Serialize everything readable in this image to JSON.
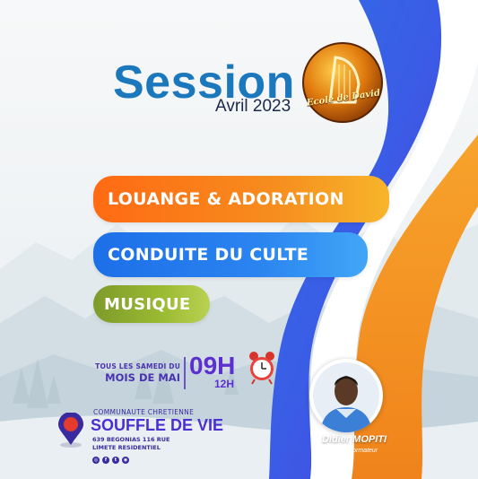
{
  "header": {
    "title": "Session",
    "subtitle": "Avril 2023",
    "logo_text": "Ecole de David"
  },
  "topics": [
    {
      "label": "LOUANGE & ADORATION",
      "color": "#f68c1e"
    },
    {
      "label": "CONDUITE DU CULTE",
      "color": "#2a84f0"
    },
    {
      "label": "MUSIQUE",
      "color": "#9bbb33"
    }
  ],
  "schedule": {
    "line1": "TOUS LES SAMEDI DU",
    "line2": "MOIS DE MAI",
    "start_time": "09H",
    "end_time": "12H",
    "icon": "alarm-clock-icon"
  },
  "location": {
    "line1": "COMMUNAUTE CHRETIENNE",
    "name": "SOUFFLE DE VIE",
    "address1": "639 BEGONIAS 116 RUE",
    "address2": "LIMETE RESIDENTIEL",
    "icon": "location-pin-icon",
    "socials": [
      "instagram-icon",
      "facebook-icon",
      "twitter-icon",
      "web-icon"
    ]
  },
  "trainer": {
    "name": "Didier MOPITI",
    "role": "Formateur"
  },
  "colors": {
    "blue_band": "#3b5ce6",
    "orange_band": "#f39a2a",
    "accent_purple": "#5b2fd0",
    "title_blue": "#1c78bd"
  }
}
